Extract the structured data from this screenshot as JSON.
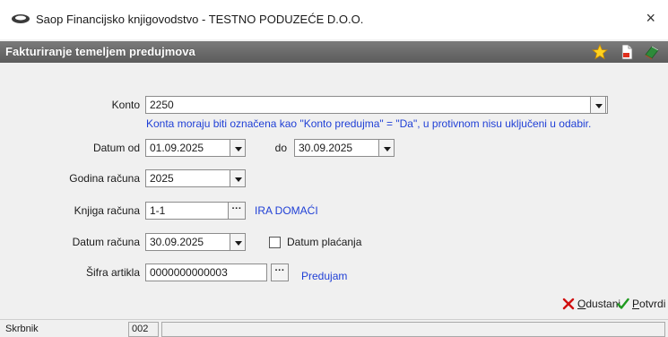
{
  "window": {
    "title": "Saop Financijsko knjigovodstvo - TESTNO PODUZEĆE D.O.O.",
    "close_glyph": "×"
  },
  "header": {
    "title": "Fakturiranje temeljem predujmova",
    "icons": [
      "star-icon",
      "document-icon",
      "books-icon"
    ]
  },
  "form": {
    "konto": {
      "label": "Konto",
      "value": "2250"
    },
    "konto_note": "Konta moraju biti označena kao \"Konto predujma\" = \"Da\", u protivnom nisu uključeni u odabir.",
    "datum_od": {
      "label": "Datum od",
      "value": "01.09.2025"
    },
    "datum_do": {
      "label": "do",
      "value": "30.09.2025"
    },
    "godina_racuna": {
      "label": "Godina računa",
      "value": "2025"
    },
    "knjiga_racuna": {
      "label": "Knjiga računa",
      "value": "1-1",
      "description": "IRA DOMAĆI"
    },
    "datum_racuna": {
      "label": "Datum računa",
      "value": "30.09.2025"
    },
    "datum_placanja": {
      "label": "Datum plaćanja",
      "checked": false
    },
    "sifra_artikla": {
      "label": "Šifra artikla",
      "value": "0000000000003",
      "description": "Predujam"
    }
  },
  "buttons": {
    "odustani": {
      "label_first": "O",
      "label_rest": "dustani"
    },
    "potvrdi": {
      "label_first": "P",
      "label_rest": "otvrdi"
    }
  },
  "status": {
    "user": "Skrbnik",
    "code": "002",
    "message": ""
  },
  "colors": {
    "header_bg": "#666666",
    "link_blue": "#1f3fd6",
    "cancel_red": "#d01010",
    "confirm_green": "#1f9a1f"
  }
}
